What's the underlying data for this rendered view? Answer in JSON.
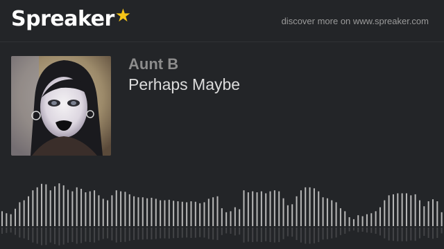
{
  "header": {
    "brand": "Spreaker",
    "brand_star": "★",
    "discover_text": "discover more on www.spreaker.com"
  },
  "episode": {
    "author": "Aunt B",
    "title": "Perhaps Maybe"
  },
  "waveform": {
    "bar_color": "#b8b8b8",
    "levels": [
      0.3,
      0.26,
      0.24,
      0.35,
      0.48,
      0.52,
      0.6,
      0.72,
      0.78,
      0.85,
      0.84,
      0.72,
      0.8,
      0.86,
      0.82,
      0.73,
      0.7,
      0.78,
      0.75,
      0.68,
      0.7,
      0.72,
      0.62,
      0.55,
      0.52,
      0.62,
      0.72,
      0.7,
      0.69,
      0.64,
      0.6,
      0.58,
      0.58,
      0.56,
      0.57,
      0.55,
      0.52,
      0.52,
      0.53,
      0.51,
      0.5,
      0.49,
      0.48,
      0.5,
      0.49,
      0.46,
      0.48,
      0.55,
      0.58,
      0.6,
      0.36,
      0.28,
      0.3,
      0.38,
      0.34,
      0.72,
      0.68,
      0.7,
      0.68,
      0.7,
      0.66,
      0.7,
      0.72,
      0.7,
      0.56,
      0.42,
      0.44,
      0.6,
      0.72,
      0.78,
      0.78,
      0.76,
      0.7,
      0.58,
      0.56,
      0.52,
      0.48,
      0.36,
      0.3,
      0.18,
      0.14,
      0.22,
      0.2,
      0.24,
      0.26,
      0.3,
      0.38,
      0.52,
      0.62,
      0.64,
      0.66,
      0.66,
      0.66,
      0.62,
      0.64,
      0.52,
      0.4,
      0.5,
      0.54,
      0.5,
      0.28
    ]
  }
}
